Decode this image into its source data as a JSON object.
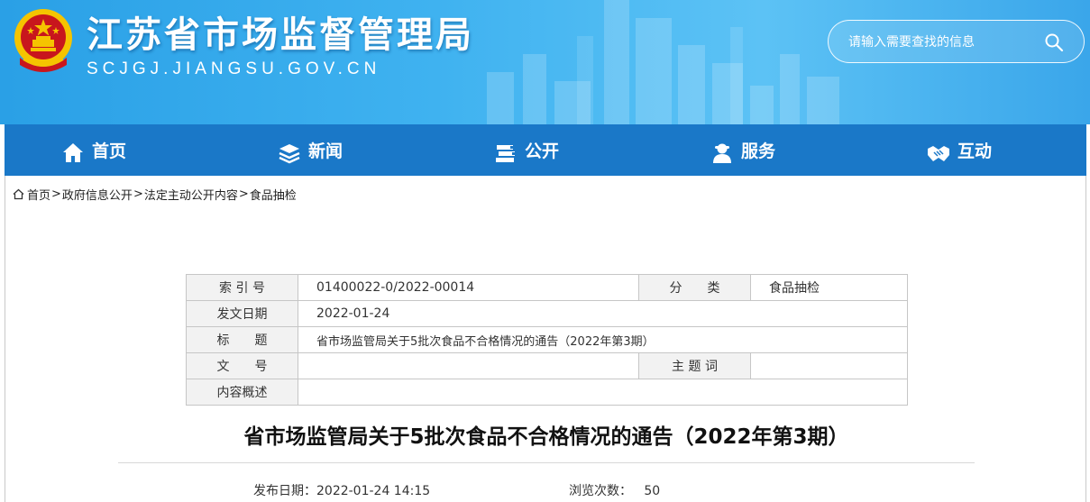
{
  "header": {
    "site_title": "江苏省市场监督管理局",
    "site_domain": "SCJGJ.JIANGSU.GOV.CN",
    "search_placeholder": "请输入需要查找的信息"
  },
  "nav": {
    "items": [
      {
        "label": "首页",
        "icon": "home-icon"
      },
      {
        "label": "新闻",
        "icon": "layers-icon"
      },
      {
        "label": "公开",
        "icon": "books-icon"
      },
      {
        "label": "服务",
        "icon": "person-icon"
      },
      {
        "label": "互动",
        "icon": "handshake-icon"
      }
    ]
  },
  "breadcrumb": {
    "items": [
      "首页",
      "政府信息公开",
      "法定主动公开内容",
      "食品抽检"
    ],
    "separator": ">"
  },
  "info_table": {
    "index_label": "索 引 号",
    "index_value": "01400022-0/2022-00014",
    "category_label": "分　　类",
    "category_value": "食品抽检",
    "date_label": "发文日期",
    "date_value": "2022-01-24",
    "title_label": "标　　题",
    "title_value": "省市场监管局关于5批次食品不合格情况的通告（2022年第3期）",
    "doc_no_label": "文　　号",
    "doc_no_value": "",
    "keywords_label": "主 题 词",
    "keywords_value": "",
    "summary_label": "内容概述",
    "summary_value": ""
  },
  "article": {
    "title": "省市场监管局关于5批次食品不合格情况的通告（2022年第3期）",
    "publish_label": "发布日期：",
    "publish_value": "2022-01-24 14:15",
    "views_label": "浏览次数：",
    "views_value": "50"
  },
  "colors": {
    "header_blue": "#3fb2f0",
    "nav_blue": "#1a78c8",
    "emblem_red": "#c8161d",
    "emblem_gold": "#f5c400"
  }
}
